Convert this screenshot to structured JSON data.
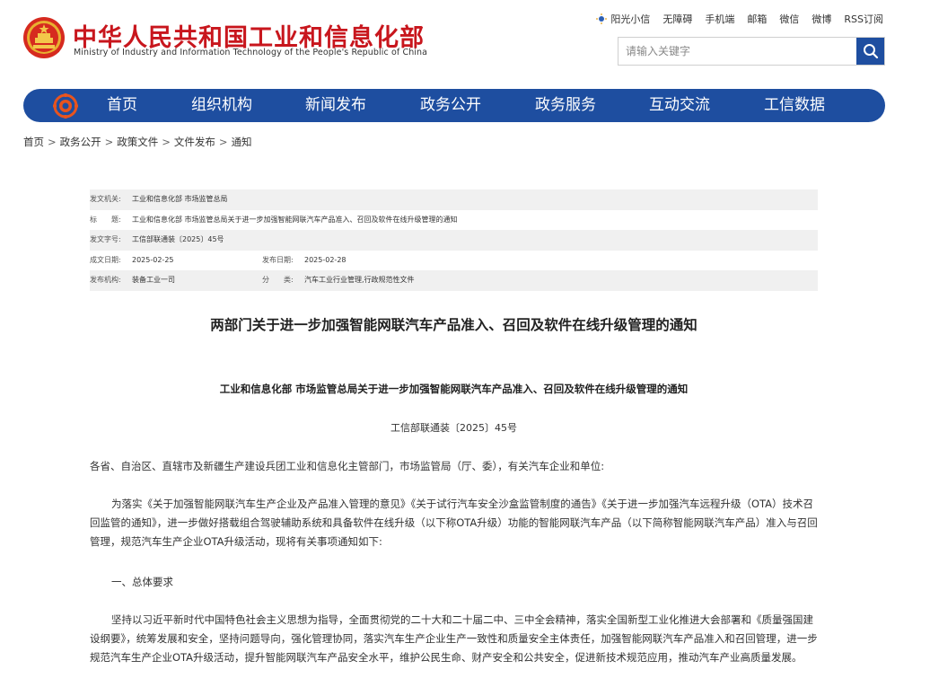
{
  "header": {
    "title": "中华人民共和国工业和信息化部",
    "subtitle": "Ministry of Industry and Information Technology of the People's Republic of China",
    "emblem_icon": "national-emblem-icon",
    "toplinks": [
      {
        "label": "阳光小信",
        "icon": "sun-icon"
      },
      {
        "label": "无障碍"
      },
      {
        "label": "手机端"
      },
      {
        "label": "邮箱"
      },
      {
        "label": "微信"
      },
      {
        "label": "微博"
      },
      {
        "label": "RSS订阅"
      }
    ],
    "search": {
      "placeholder": "请输入关键字",
      "icon": "search-icon"
    }
  },
  "nav": {
    "logo_icon": "miit-logo-icon",
    "items": [
      "首页",
      "组织机构",
      "新闻发布",
      "政务公开",
      "政务服务",
      "互动交流",
      "工信数据"
    ]
  },
  "breadcrumb": [
    "首页",
    "政务公开",
    "政策文件",
    "文件发布",
    "通知"
  ],
  "breadcrumb_sep": ">",
  "meta": {
    "issuer_label": "发文机关:",
    "issuer": "工业和信息化部 市场监管总局",
    "title_label": "标　　题:",
    "title": "工业和信息化部 市场监管总局关于进一步加强智能网联汽车产品准入、召回及软件在线升级管理的通知",
    "docno_label": "发文字号:",
    "docno": "工信部联通装〔2025〕45号",
    "created_label": "成文日期:",
    "created": "2025-02-25",
    "published_label": "发布日期:",
    "published": "2025-02-28",
    "org_label": "发布机构:",
    "org": "装备工业一司",
    "category_label": "分　　类:",
    "category": "汽车工业行业管理,行政规范性文件"
  },
  "article": {
    "title": "两部门关于进一步加强智能网联汽车产品准入、召回及软件在线升级管理的通知",
    "subtitle": "工业和信息化部 市场监管总局关于进一步加强智能网联汽车产品准入、召回及软件在线升级管理的通知",
    "docno": "工信部联通装〔2025〕45号",
    "addressee": "各省、自治区、直辖市及新疆生产建设兵团工业和信息化主管部门，市场监管局（厅、委），有关汽车企业和单位:",
    "para1": "为落实《关于加强智能网联汽车生产企业及产品准入管理的意见》《关于试行汽车安全沙盒监管制度的通告》《关于进一步加强汽车远程升级（OTA）技术召回监管的通知》，进一步做好搭载组合驾驶辅助系统和具备软件在线升级（以下称OTA升级）功能的智能网联汽车产品（以下简称智能网联汽车产品）准入与召回管理，规范汽车生产企业OTA升级活动，现将有关事项通知如下:",
    "section1": "一、总体要求",
    "para2": "坚持以习近平新时代中国特色社会主义思想为指导，全面贯彻党的二十大和二十届二中、三中全会精神，落实全国新型工业化推进大会部署和《质量强国建设纲要》，统筹发展和安全，坚持问题导向，强化管理协同，落实汽车生产企业生产一致性和质量安全主体责任，加强智能网联汽车产品准入和召回管理，进一步规范汽车生产企业OTA升级活动，提升智能网联汽车产品安全水平，维护公民生命、财产安全和公共安全，促进新技术规范应用，推动汽车产业高质量发展。"
  },
  "colors": {
    "brand_red": "#c8161d",
    "nav_blue": "#1e4ea0",
    "meta_shade": "#f0f0f0"
  }
}
